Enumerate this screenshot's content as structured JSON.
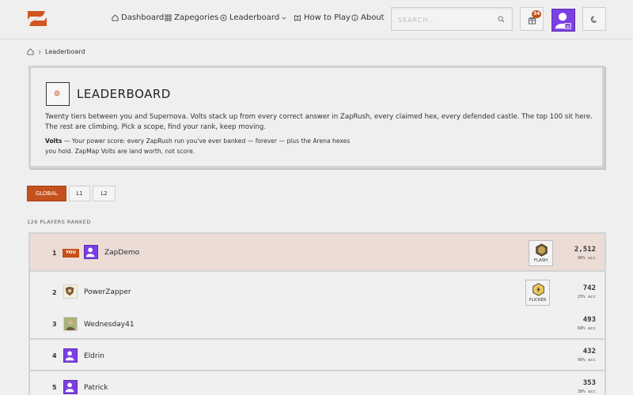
{
  "header": {
    "nav": [
      {
        "label": "Dashboard",
        "icon": "home-icon"
      },
      {
        "label": "Zapegories",
        "icon": "grid-icon"
      },
      {
        "label": "Leaderboard",
        "icon": "target-icon"
      },
      {
        "label": "How to Play",
        "icon": "book-icon"
      },
      {
        "label": "About",
        "icon": "info-icon"
      }
    ],
    "search_placeholder": "SEARCH...",
    "notification_count": "34",
    "accent": "#c4511c"
  },
  "breadcrumb": {
    "current": "Leaderboard"
  },
  "info": {
    "title": "LEADERBOARD",
    "description": "Twenty tiers between you and Supernova. Volts stack up from every correct answer in ZapRush, every claimed hex, every defended castle. The top 100 sit here. The rest are climbing. Pick a scope, find your rank, keep moving.",
    "volts_term": "Volts",
    "volts_line1": " — Your power score: every ZapRush run you've ever banked — forever — plus the Arena hexes",
    "volts_line2": "you hold. ZapMap Volts are land worth, not score."
  },
  "tabs": [
    {
      "label": "GLOBAL",
      "active": true
    },
    {
      "label": "L1",
      "active": false
    },
    {
      "label": "L2",
      "active": false
    }
  ],
  "players_ranked": "126 PLAYERS RANKED",
  "rows": [
    {
      "rank": "1",
      "you": "YOU",
      "name": "ZapDemo",
      "tier": "FLASH",
      "volts": "2,512",
      "acc": "96% acc"
    },
    {
      "rank": "2",
      "name": "PowerZapper",
      "tier": "FLICKER",
      "volts": "742",
      "acc": "25% acc"
    },
    {
      "rank": "3",
      "name": "Wednesday41",
      "volts": "493",
      "acc": "68% acc"
    },
    {
      "rank": "4",
      "name": "Eldrin",
      "volts": "432",
      "acc": "90% acc"
    },
    {
      "rank": "5",
      "name": "Patrick",
      "volts": "353",
      "acc": "38% acc"
    }
  ]
}
